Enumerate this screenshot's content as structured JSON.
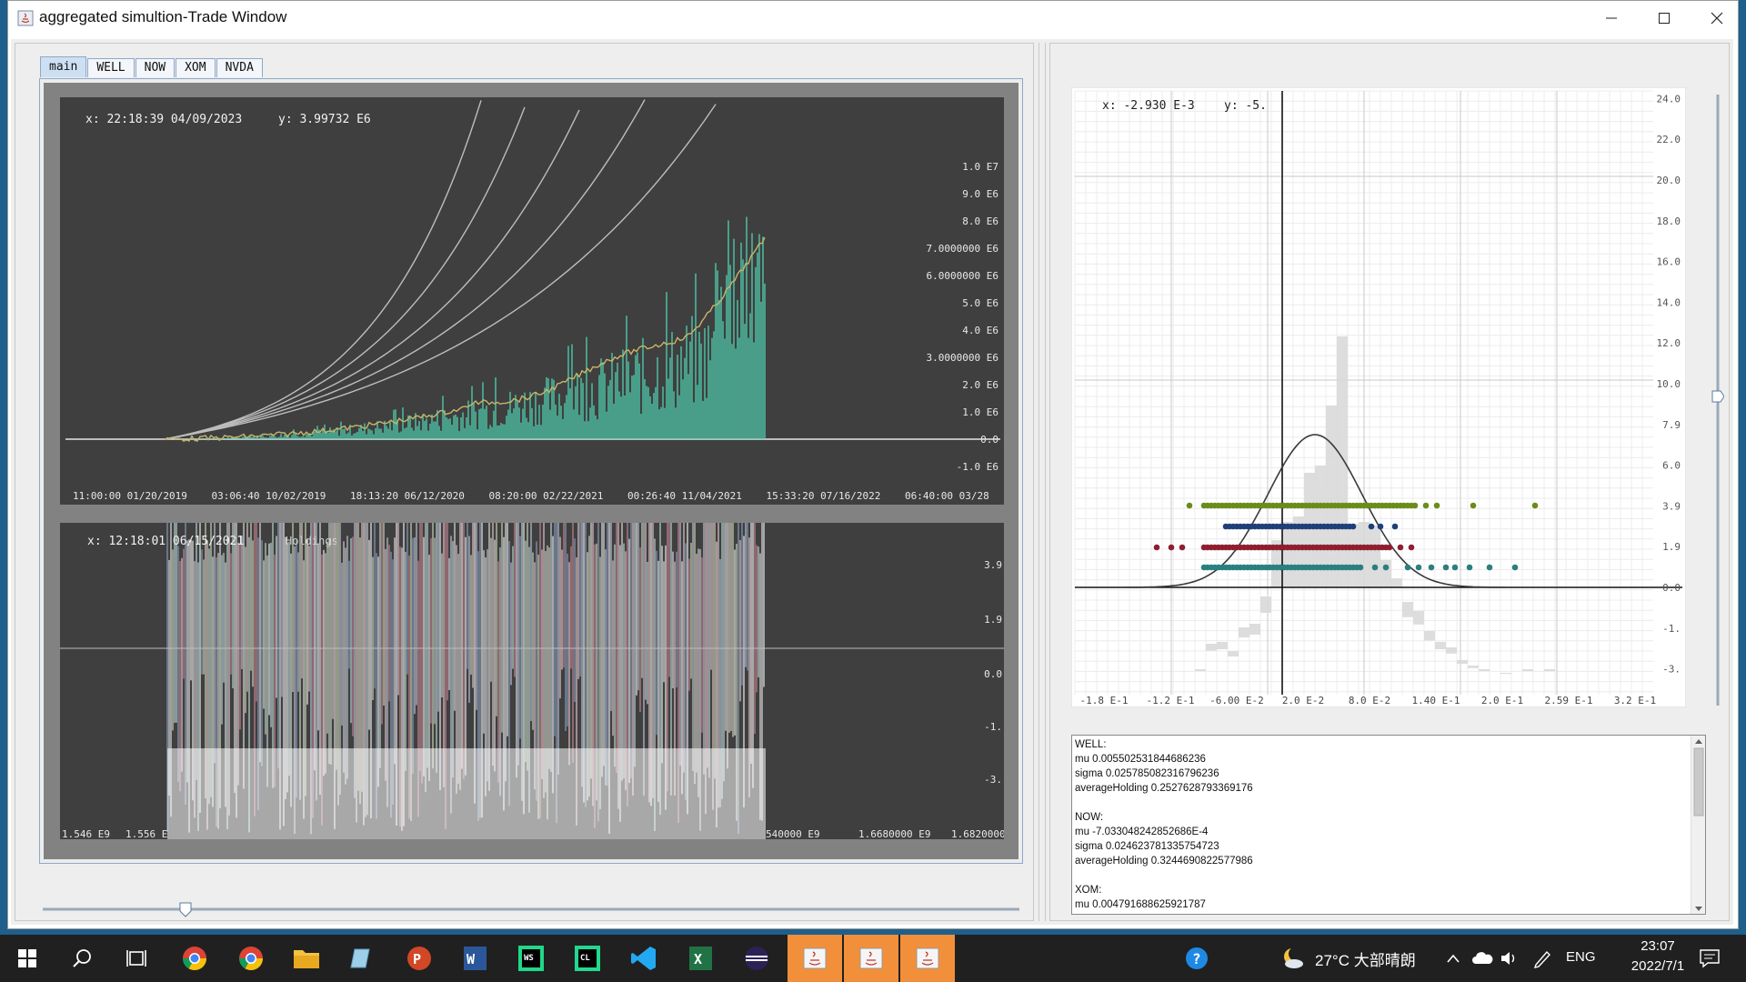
{
  "window": {
    "title": "aggregated simultion-Trade Window",
    "controls": [
      "─",
      "☐",
      "✕"
    ]
  },
  "tabs": [
    {
      "label": "main",
      "active": true
    },
    {
      "label": "WELL",
      "active": false
    },
    {
      "label": "NOW",
      "active": false
    },
    {
      "label": "XOM",
      "active": false
    },
    {
      "label": "NVDA",
      "active": false
    }
  ],
  "price_chart": {
    "readout_x": "x: 22:18:39 04/09/2023",
    "readout_y": "y: 3.99732 E6",
    "y_ticks": [
      "1.0 E7",
      "9.0 E6",
      "8.0 E6",
      "7.0000000 E6",
      "6.0000000 E6",
      "5.0 E6",
      "4.0 E6",
      "3.0000000 E6",
      "2.0 E6",
      "1.0 E6",
      "0.0",
      "-1.0 E6"
    ],
    "x_ticks": [
      "11:00:00 01/20/2019",
      "03:06:40 10/02/2019",
      "18:13:20 06/12/2020",
      "08:20:00 02/22/2021",
      "00:26:40 11/04/2021",
      "15:33:20 07/16/2022",
      "06:40:00 03/28"
    ],
    "colors": {
      "background": "#3f3f3f",
      "volume": "#4fd1b1",
      "curves": "#bdbdbd"
    }
  },
  "holdings_chart": {
    "readout": "x: 12:18:01 06/15/2021",
    "legend": "Holdings",
    "y_ticks": [
      "3.9",
      "1.9",
      "0.0",
      "-1.",
      "-3."
    ],
    "x_ticks": [
      "1.546 E9",
      "1.556 E",
      "540000 E9",
      "1.6680000 E9",
      "1.6820000 E9"
    ]
  },
  "dist_chart": {
    "readout_x": "x: -2.930 E-3",
    "readout_y": "y: -5.",
    "y_ticks": [
      "24.0",
      "22.0",
      "20.0",
      "18.0",
      "16.0",
      "14.0",
      "12.0",
      "10.0",
      "7.9",
      "6.0",
      "3.9",
      "1.9",
      "0.0",
      "-1.",
      "-3."
    ],
    "x_ticks": [
      "-1.8 E-1",
      "-1.2 E-1",
      "-6.00 E-2",
      "2.0 E-2",
      "8.0 E-2",
      "1.40 E-1",
      "2.0 E-1",
      "2.59 E-1",
      "3.2 E-1"
    ],
    "series_colors": [
      "#6b8c1a",
      "#1f3f7a",
      "#8e1f2f",
      "#2a7f7f"
    ]
  },
  "stats": {
    "lines": [
      "WELL:",
      "mu 0.0055025318446862​36",
      "sigma 0.025785082316796236",
      "averageHolding 0.2527628793369176",
      "",
      "NOW:",
      "mu -7.033048242852686E-4",
      "sigma 0.024623781335754723",
      "averageHolding 0.3244690822577986",
      "",
      "XOM:",
      "mu 0.004791688625921787"
    ]
  },
  "taskbar": {
    "weather": "27°C 大部晴朗",
    "lang": "ENG",
    "time": "23:07",
    "date": "2022/7/1"
  }
}
